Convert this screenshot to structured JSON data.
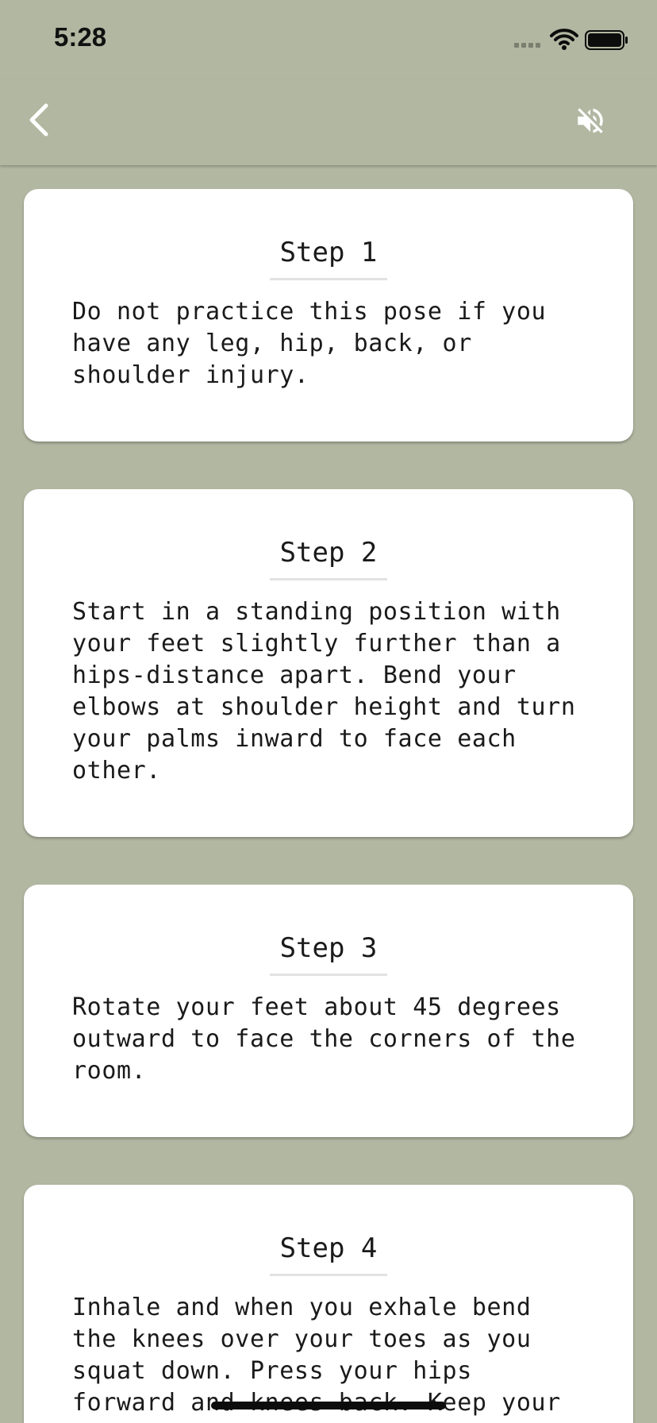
{
  "status_bar": {
    "time": "5:28"
  },
  "nav": {
    "back_icon": "chevron-left-icon",
    "mute_icon": "speaker-muted-icon",
    "icon_color": "#ffffff",
    "background": "#b2b7a2"
  },
  "steps": [
    {
      "title": "Step 1",
      "text": "Do not practice this pose if you have any leg, hip, back, or shoulder injury."
    },
    {
      "title": "Step 2",
      "text": "Start in a standing position with your feet slightly further than a hips-distance apart. Bend your elbows at shoulder height and turn your palms inward to face each other."
    },
    {
      "title": "Step 3",
      "text": "Rotate your feet about 45 degrees outward to face the corners of the room."
    },
    {
      "title": "Step 4",
      "text": "Inhale and when you exhale bend the knees over your toes as you squat down. Press your hips forward and knees back. Keep your"
    }
  ]
}
